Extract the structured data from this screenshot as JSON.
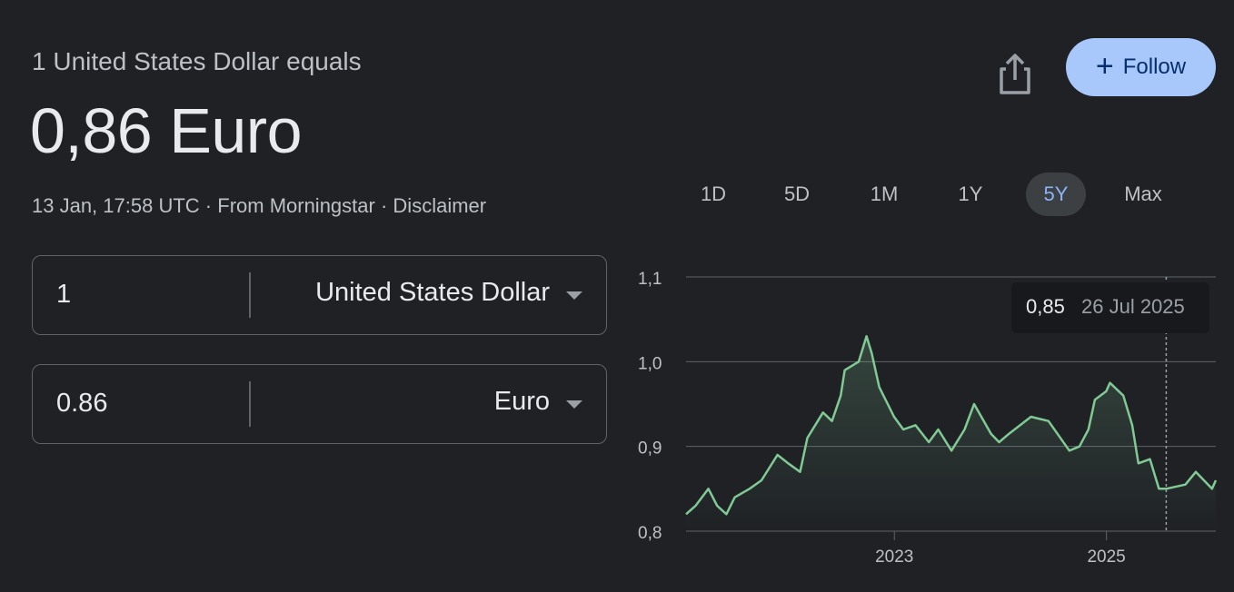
{
  "header": {
    "subtitle": "1 United States Dollar equals",
    "rate": "0,86 Euro",
    "timestamp": "13 Jan, 17:58 UTC",
    "separator": "·",
    "source": "From Morningstar",
    "disclaimer": "Disclaimer"
  },
  "actions": {
    "share_icon": "share-icon",
    "follow_label": "Follow",
    "follow_icon": "plus-icon"
  },
  "converter": {
    "from": {
      "amount": "1",
      "currency": "United States Dollar"
    },
    "to": {
      "amount": "0.86",
      "currency": "Euro"
    }
  },
  "ranges": [
    "1D",
    "5D",
    "1M",
    "1Y",
    "5Y",
    "Max"
  ],
  "active_range": "5Y",
  "tooltip": {
    "value": "0,85",
    "date": "26 Jul 2025"
  },
  "colors": {
    "background": "#1f2125",
    "accent": "#a8c7fa",
    "line": "#81c995",
    "active_range_text": "#8ab4f8"
  },
  "chart_data": {
    "type": "line",
    "x_tick_labels": [
      "2023",
      "2025"
    ],
    "y_tick_labels": [
      "1,1",
      "1,0",
      "0,9",
      "0,8"
    ],
    "ylim": [
      0.8,
      1.1
    ],
    "xlim": [
      "2021-01-13",
      "2026-01-13"
    ],
    "grid": true,
    "series": [
      {
        "x": [
          "2021-01-13",
          "2021-02-15",
          "2021-03-31",
          "2021-04-30",
          "2021-06-01",
          "2021-06-30",
          "2021-08-20",
          "2021-09-30",
          "2021-11-24",
          "2021-12-31",
          "2022-02-10",
          "2022-03-07",
          "2022-04-30",
          "2022-05-31",
          "2022-06-30",
          "2022-07-14",
          "2022-08-31",
          "2022-09-27",
          "2022-10-15",
          "2022-11-10",
          "2022-12-31",
          "2023-02-01",
          "2023-03-15",
          "2023-04-30",
          "2023-06-01",
          "2023-07-17",
          "2023-08-31",
          "2023-10-03",
          "2023-11-30",
          "2023-12-28",
          "2024-01-31",
          "2024-04-16",
          "2024-06-15",
          "2024-08-26",
          "2024-09-30",
          "2024-10-31",
          "2024-11-22",
          "2024-12-31",
          "2025-01-13",
          "2025-02-28",
          "2025-03-31",
          "2025-04-21",
          "2025-05-31",
          "2025-07-01",
          "2025-07-26",
          "2025-09-30",
          "2025-11-05",
          "2025-12-31",
          "2026-01-13"
        ],
        "y": [
          0.82,
          0.83,
          0.85,
          0.83,
          0.82,
          0.84,
          0.85,
          0.86,
          0.89,
          0.88,
          0.87,
          0.91,
          0.94,
          0.93,
          0.96,
          0.99,
          1.0,
          1.03,
          1.01,
          0.97,
          0.935,
          0.92,
          0.925,
          0.905,
          0.92,
          0.895,
          0.92,
          0.95,
          0.915,
          0.905,
          0.915,
          0.935,
          0.93,
          0.895,
          0.9,
          0.92,
          0.955,
          0.965,
          0.975,
          0.96,
          0.925,
          0.88,
          0.885,
          0.85,
          0.85,
          0.855,
          0.87,
          0.85,
          0.86
        ]
      }
    ]
  }
}
